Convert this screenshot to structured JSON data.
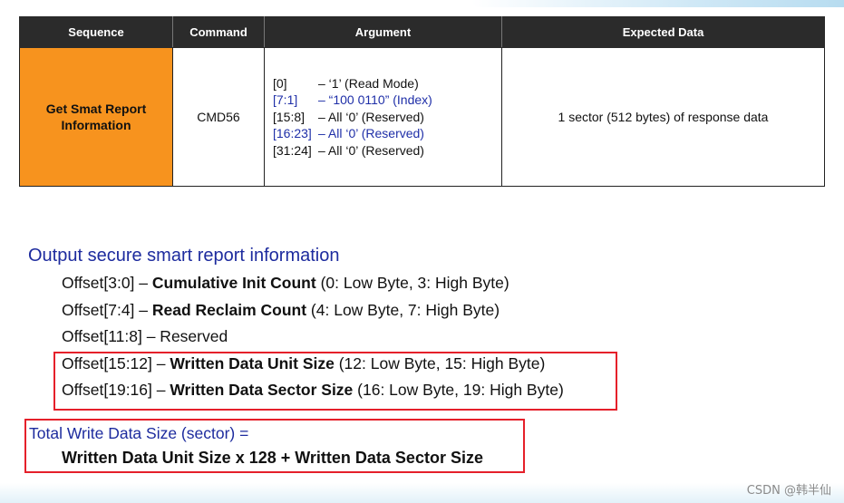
{
  "table": {
    "headers": [
      "Sequence",
      "Command",
      "Argument",
      "Expected Data"
    ],
    "row": {
      "sequence_line1": "Get Smat Report",
      "sequence_line2": "Information",
      "command": "CMD56",
      "arguments": [
        {
          "bits": "[0]",
          "desc": "– ‘1’ (Read Mode)",
          "highlight": false
        },
        {
          "bits": "[7:1]",
          "desc": "– “100 0110” (Index)",
          "highlight": true
        },
        {
          "bits": "[15:8]",
          "desc": "– All ‘0’ (Reserved)",
          "highlight": false
        },
        {
          "bits": "[16:23]",
          "desc": "– All ‘0’ (Reserved)",
          "highlight": true
        },
        {
          "bits": "[31:24]",
          "desc": "– All ‘0’ (Reserved)",
          "highlight": false
        }
      ],
      "expected_data": "1 sector (512 bytes) of response data"
    },
    "colors": {
      "header_bg": "#2b2b2b",
      "sequence_bg": "#f7931e",
      "highlight_text": "#1f2fa8"
    }
  },
  "section": {
    "heading": "Output secure smart report information",
    "offsets": [
      {
        "prefix": "Offset[3:0] – ",
        "bold": "Cumulative Init Count",
        "suffix": " (0: Low Byte, 3: High Byte)"
      },
      {
        "prefix": "Offset[7:4] – ",
        "bold": "Read Reclaim Count",
        "suffix": " (4: Low Byte, 7: High Byte)"
      },
      {
        "prefix": "Offset[11:8] – Reserved",
        "bold": "",
        "suffix": ""
      },
      {
        "prefix": "Offset[15:12] – ",
        "bold": "Written Data Unit Size",
        "suffix": " (12: Low Byte, 15: High Byte)"
      },
      {
        "prefix": "Offset[19:16] – ",
        "bold": "Written Data Sector Size",
        "suffix": " (16: Low Byte, 19: High Byte)"
      }
    ],
    "total_label": "Total Write Data Size (sector) =",
    "formula": "Written Data Unit Size x 128 + Written Data Sector Size",
    "colors": {
      "heading": "#1d2b9e",
      "box_border": "#e5202a"
    }
  },
  "watermark": "CSDN @韩半仙"
}
